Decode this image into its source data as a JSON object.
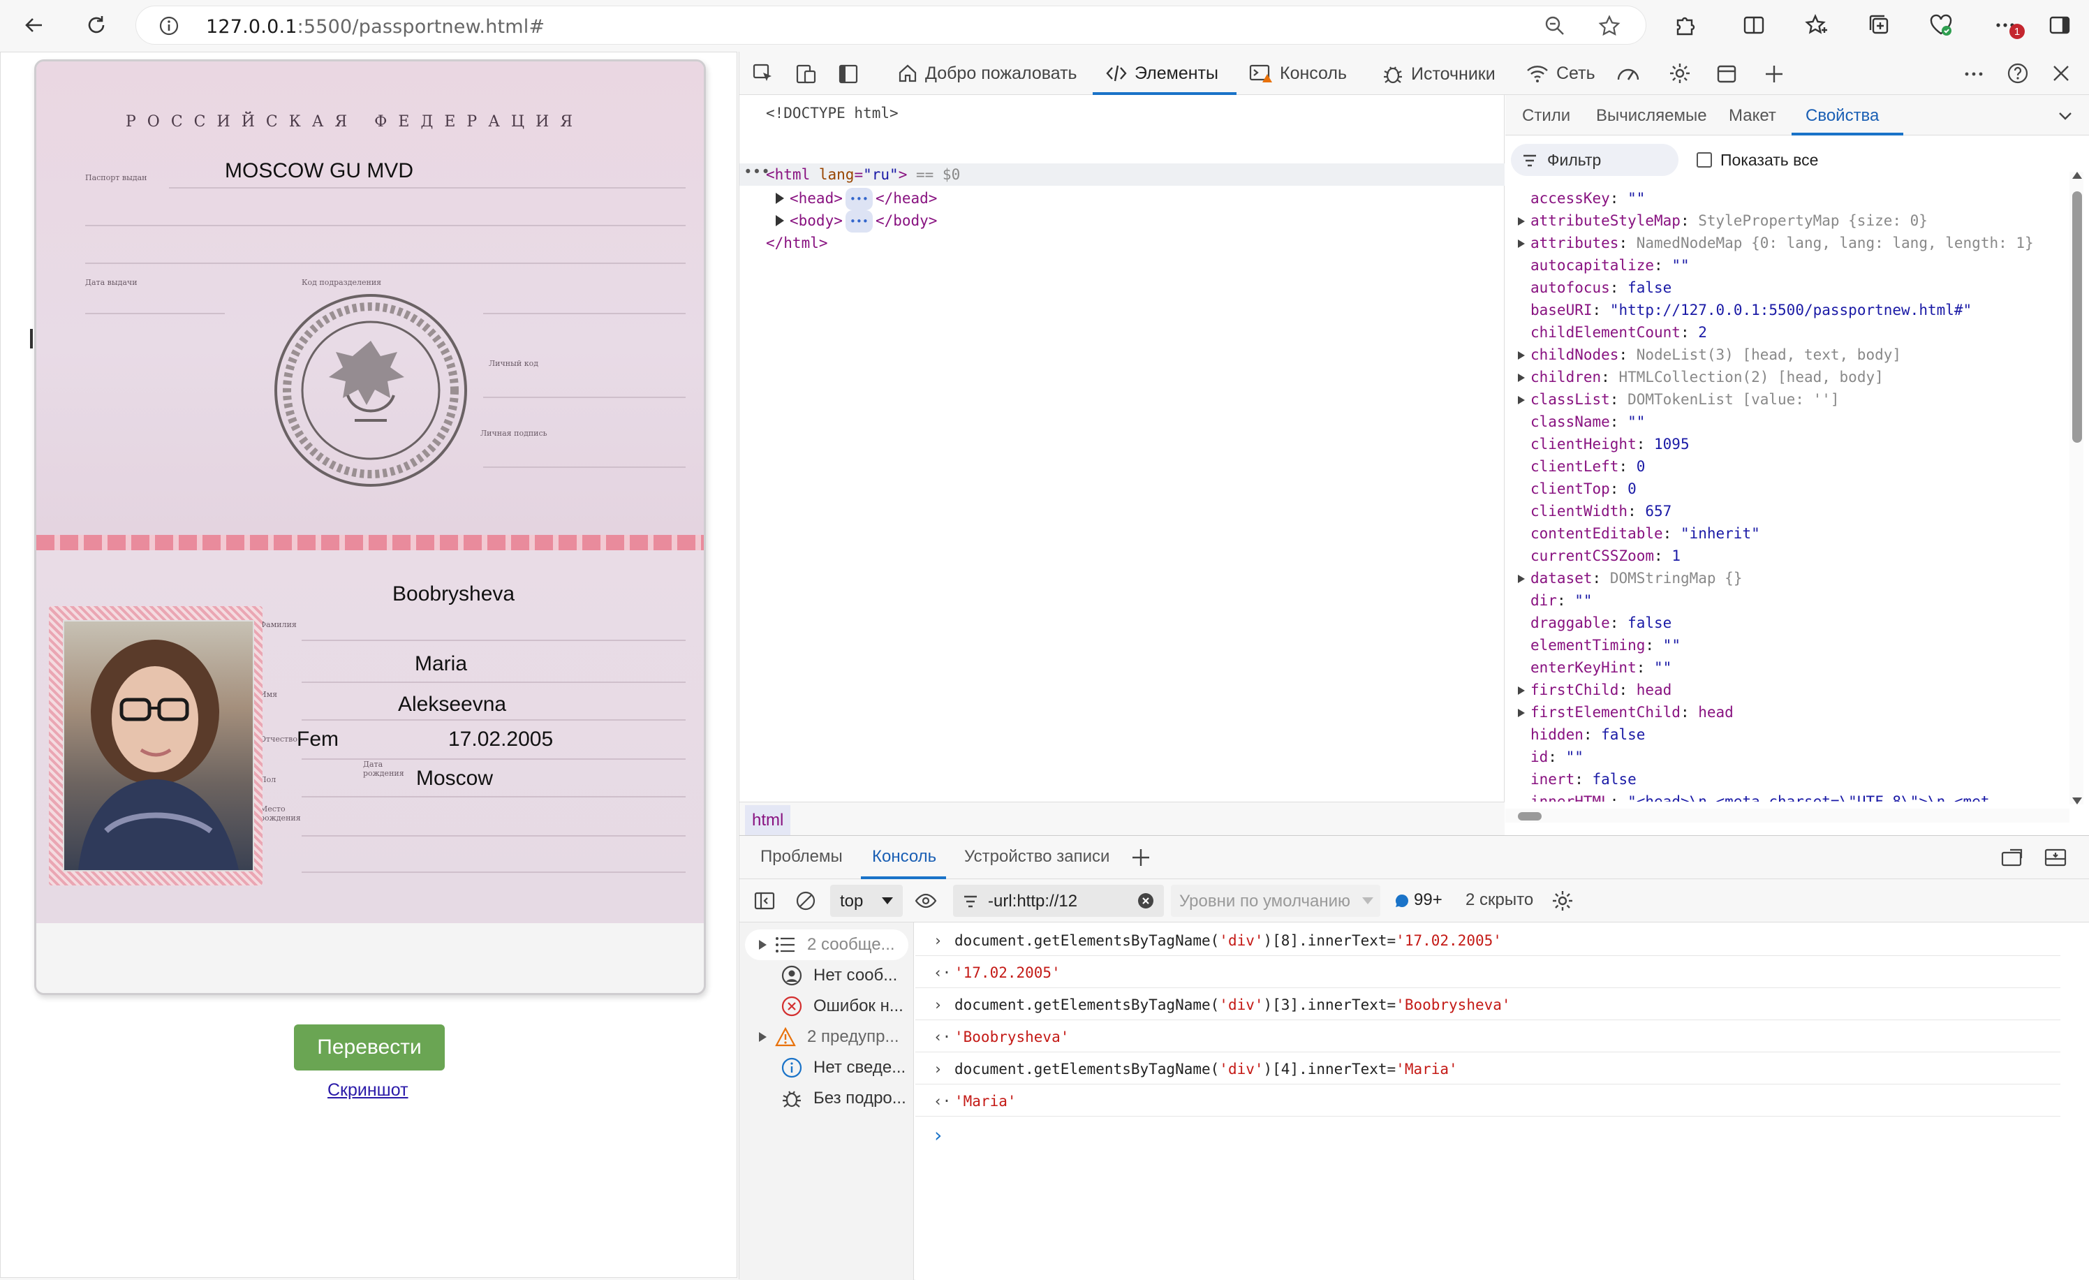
{
  "browser": {
    "url_host": "127.0.0.1",
    "url_rest": ":5500/passportnew.html#",
    "update_badge": "1"
  },
  "passport": {
    "country": "РОССИЙСКАЯ ФЕДЕРАЦИЯ",
    "label_issued_by": "Паспорт выдан",
    "label_issue_date": "Дата выдачи",
    "label_dept_code": "Код подразделения",
    "label_personal_code": "Личный код",
    "label_signature": "Личная подпись",
    "label_surname": "Фамилия",
    "label_name": "Имя",
    "label_patronymic": "Отчество",
    "label_sex": "Пол",
    "label_birth_date": "Дата рождения",
    "label_birth_place": "Место рождения",
    "issued_by": "MOSCOW GU MVD",
    "surname": "Boobrysheva",
    "name": "Maria",
    "patronymic": "Alekseevna",
    "sex": "Fem",
    "birth_date": "17.02.2005",
    "birth_place": "Moscow"
  },
  "page": {
    "translate_button": "Перевести",
    "screenshot_link": "Скриншот"
  },
  "devtools": {
    "tabs": [
      "Добро пожаловать",
      "Элементы",
      "Консоль",
      "Источники",
      "Сеть"
    ],
    "dom": {
      "doctype": "<!DOCTYPE html>",
      "html_open": "<html",
      "attr_lang": "lang",
      "attr_lang_val": "\"ru\"",
      "html_close_br": ">",
      "eq0": "== $0",
      "head": "<head>",
      "head_close": "</head>",
      "body": "<body>",
      "body_close": "</body>",
      "html_end": "</html>",
      "dots": "•••"
    },
    "breadcrumb": "html",
    "side_tabs": [
      "Стили",
      "Вычисляемые",
      "Макет",
      "Свойства"
    ],
    "filter_placeholder": "Фильтр",
    "show_all": "Показать все",
    "properties": [
      {
        "k": "accessKey",
        "v": "\"\"",
        "t": "s",
        "exp": false
      },
      {
        "k": "attributeStyleMap",
        "v": "StylePropertyMap {size: 0}",
        "t": "o",
        "exp": true
      },
      {
        "k": "attributes",
        "v": "NamedNodeMap {0: lang, lang: lang, length: 1}",
        "t": "o",
        "exp": true
      },
      {
        "k": "autocapitalize",
        "v": "\"\"",
        "t": "s",
        "exp": false
      },
      {
        "k": "autofocus",
        "v": "false",
        "t": "n",
        "exp": false
      },
      {
        "k": "baseURI",
        "v": "\"http://127.0.0.1:5500/passportnew.html#\"",
        "t": "s",
        "exp": false
      },
      {
        "k": "childElementCount",
        "v": "2",
        "t": "n",
        "exp": false
      },
      {
        "k": "childNodes",
        "v": "NodeList(3) [head, text, body]",
        "t": "o",
        "exp": true
      },
      {
        "k": "children",
        "v": "HTMLCollection(2) [head, body]",
        "t": "o",
        "exp": true
      },
      {
        "k": "classList",
        "v": "DOMTokenList [value: '']",
        "t": "o",
        "exp": true
      },
      {
        "k": "className",
        "v": "\"\"",
        "t": "s",
        "exp": false
      },
      {
        "k": "clientHeight",
        "v": "1095",
        "t": "n",
        "exp": false
      },
      {
        "k": "clientLeft",
        "v": "0",
        "t": "n",
        "exp": false
      },
      {
        "k": "clientTop",
        "v": "0",
        "t": "n",
        "exp": false
      },
      {
        "k": "clientWidth",
        "v": "657",
        "t": "n",
        "exp": false
      },
      {
        "k": "contentEditable",
        "v": "\"inherit\"",
        "t": "s",
        "exp": false
      },
      {
        "k": "currentCSSZoom",
        "v": "1",
        "t": "n",
        "exp": false
      },
      {
        "k": "dataset",
        "v": "DOMStringMap {}",
        "t": "o",
        "exp": true
      },
      {
        "k": "dir",
        "v": "\"\"",
        "t": "s",
        "exp": false
      },
      {
        "k": "draggable",
        "v": "false",
        "t": "n",
        "exp": false
      },
      {
        "k": "elementTiming",
        "v": "\"\"",
        "t": "s",
        "exp": false
      },
      {
        "k": "enterKeyHint",
        "v": "\"\"",
        "t": "s",
        "exp": false
      },
      {
        "k": "firstChild",
        "v": "head",
        "t": "h",
        "exp": true
      },
      {
        "k": "firstElementChild",
        "v": "head",
        "t": "h",
        "exp": true
      },
      {
        "k": "hidden",
        "v": "false",
        "t": "n",
        "exp": false
      },
      {
        "k": "id",
        "v": "\"\"",
        "t": "s",
        "exp": false
      },
      {
        "k": "inert",
        "v": "false",
        "t": "n",
        "exp": false
      },
      {
        "k": "innerHTML",
        "v": "\"<head>\\n    <meta charset=\\\"UTF-8\\\">\\n    <met",
        "t": "s",
        "exp": false
      }
    ],
    "drawer_tabs": [
      "Проблемы",
      "Консоль",
      "Устройство записи"
    ],
    "console_context": "top",
    "console_filter": "-url:http://12",
    "console_levels": "Уровни по умолчанию",
    "issues_count": "99+",
    "hidden_count": "2 скрыто",
    "sidebar": [
      "2 сообще...",
      "Нет сооб...",
      "Ошибок н...",
      "2 предупр...",
      "Нет сведе...",
      "Без подро..."
    ],
    "console": [
      {
        "dir": "in",
        "pre": "document.getElementsByTagName(",
        "s1": "'div'",
        "mid": ")[8].innerText=",
        "s2": "'17.02.2005'"
      },
      {
        "dir": "out",
        "val": "'17.02.2005'"
      },
      {
        "dir": "in",
        "pre": "document.getElementsByTagName(",
        "s1": "'div'",
        "mid": ")[3].innerText=",
        "s2": "'Boobrysheva'"
      },
      {
        "dir": "out",
        "val": "'Boobrysheva'"
      },
      {
        "dir": "in",
        "pre": "document.getElementsByTagName(",
        "s1": "'div'",
        "mid": ")[4].innerText=",
        "s2": "'Maria'"
      },
      {
        "dir": "out",
        "val": "'Maria'"
      }
    ]
  }
}
